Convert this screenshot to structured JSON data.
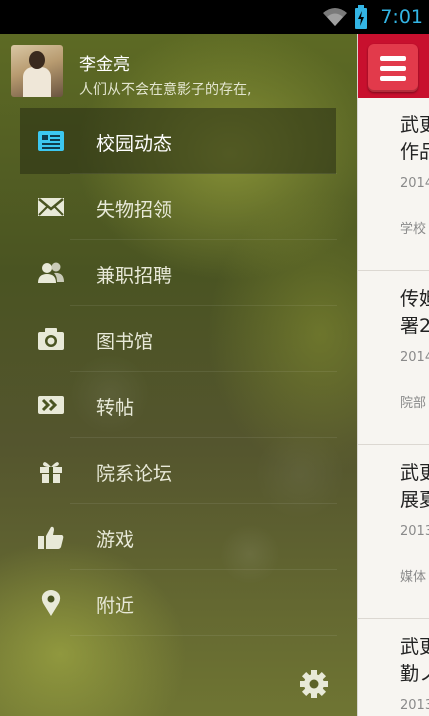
{
  "status_bar": {
    "time": "7:01"
  },
  "profile": {
    "name": "李金亮",
    "signature": "人们从不会在意影子的存在,"
  },
  "menu": [
    {
      "label": "校园动态",
      "icon": "campus-news-icon",
      "active": true
    },
    {
      "label": "失物招领",
      "icon": "envelope-icon",
      "active": false
    },
    {
      "label": "兼职招聘",
      "icon": "people-icon",
      "active": false
    },
    {
      "label": "图书馆",
      "icon": "camera-icon",
      "active": false
    },
    {
      "label": "转帖",
      "icon": "forward-icon",
      "active": false
    },
    {
      "label": "院系论坛",
      "icon": "gift-icon",
      "active": false
    },
    {
      "label": "游戏",
      "icon": "thumbs-up-icon",
      "active": false
    },
    {
      "label": "附近",
      "icon": "location-pin-icon",
      "active": false
    }
  ],
  "news": [
    {
      "title_line1": "武更",
      "title_line2": "作品",
      "date": "2014",
      "source": "学校"
    },
    {
      "title_line1": "传妲",
      "title_line2": "署2",
      "date": "2014",
      "source": "院部"
    },
    {
      "title_line1": "武更",
      "title_line2": "展夏",
      "date": "2013",
      "source": "媒体"
    },
    {
      "title_line1": "武更",
      "title_line2": "勤ノ",
      "date": "2013",
      "source": ""
    }
  ],
  "colors": {
    "accent": "#c8102e",
    "active_icon": "#3cc8f0",
    "status_blue": "#33b5e5"
  }
}
